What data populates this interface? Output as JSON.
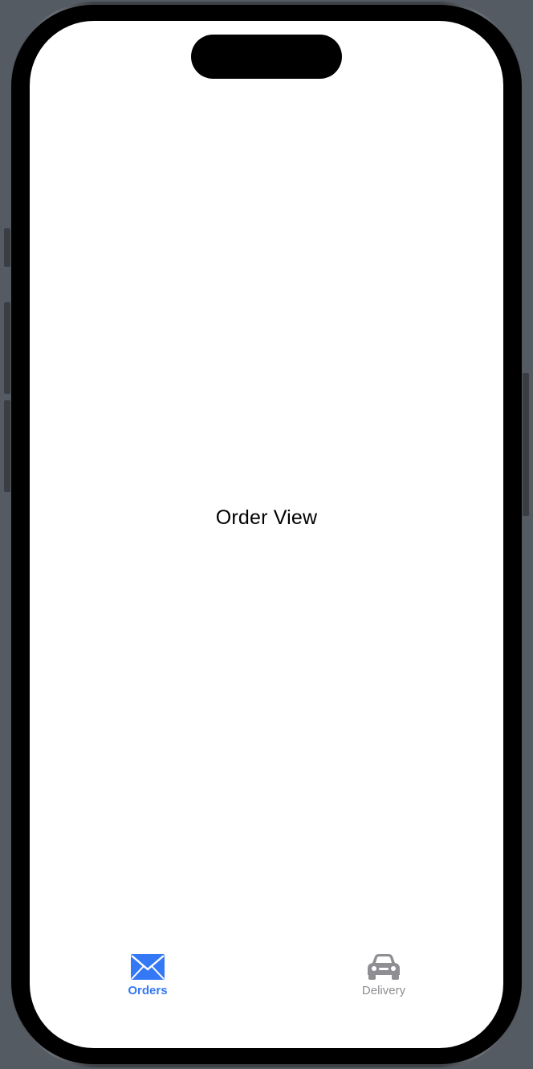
{
  "main": {
    "title": "Order View"
  },
  "tabbar": {
    "tabs": [
      {
        "label": "Orders",
        "icon": "envelope-icon",
        "selected": true
      },
      {
        "label": "Delivery",
        "icon": "car-icon",
        "selected": false
      }
    ]
  },
  "colors": {
    "accent": "#3478f6",
    "inactive": "#8e8e93",
    "background": "#ffffff"
  }
}
